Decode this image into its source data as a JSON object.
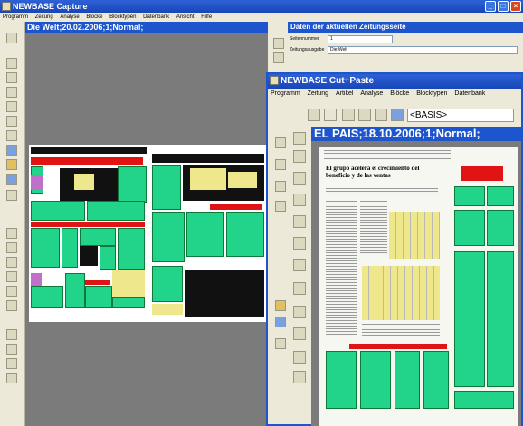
{
  "capture_window": {
    "title": "NEWBASE Capture",
    "menu": [
      "Programm",
      "Zeitung",
      "Analyse",
      "Blöcke",
      "Blocktypen",
      "Datenbank",
      "Ansicht",
      "Hilfe"
    ],
    "document_label": "Die Welt;20.02.2006;1;Normal;"
  },
  "page_data_panel": {
    "title": "Daten der aktuellen Zeitungsseite",
    "fields": [
      {
        "label": "Seitennummer",
        "value": "1"
      },
      {
        "label": "Zeitungsausgabe",
        "value": "Die Welt"
      }
    ]
  },
  "cutpaste_window": {
    "title": "NEWBASE Cut+Paste",
    "menu": [
      "Programm",
      "Zeitung",
      "Artikel",
      "Analyse",
      "Blöcke",
      "Blocktypen",
      "Datenbank"
    ],
    "basis_select": "<BASIS>",
    "document_label": "EL PAIS;18.10.2006;1;Normal;",
    "article_headline": "El grupo acelera el crecimiento del beneficio y de las ventas"
  },
  "colors": {
    "title_bar": "#1846b8",
    "label_bar": "#1d55cc",
    "article_block": "#22d38a",
    "headline_block": "#e01414"
  }
}
